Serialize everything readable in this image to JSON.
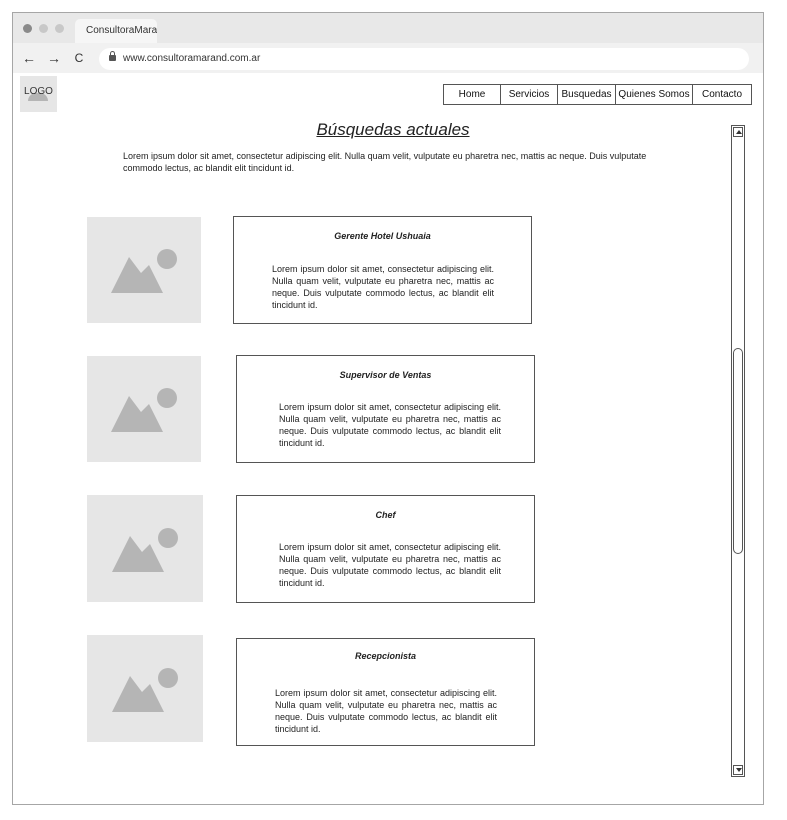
{
  "browser": {
    "tab_title": "ConsultoraMarand",
    "url": "www.consultoramarand.com.ar",
    "back_icon": "←",
    "forward_icon": "→",
    "reload_icon": "C"
  },
  "logo": {
    "text": "LOGO"
  },
  "nav": {
    "items": [
      "Home",
      "Servicios",
      "Busquedas",
      "Quienes Somos",
      "Contacto"
    ]
  },
  "page": {
    "title": "Búsquedas actuales",
    "intro": "Lorem ipsum dolor sit amet, consectetur adipiscing elit. Nulla quam velit, vulputate eu pharetra nec, mattis ac neque. Duis vulputate commodo lectus, ac blandit elit tincidunt id."
  },
  "jobs": [
    {
      "title": "Gerente Hotel Ushuaia",
      "body": "Lorem ipsum dolor sit amet, consectetur adipiscing elit. Nulla quam velit, vulputate eu pharetra nec, mattis ac neque. Duis vulputate commodo lectus, ac blandit elit tincidunt id."
    },
    {
      "title": "Supervisor de Ventas",
      "body": "Lorem ipsum dolor sit amet, consectetur adipiscing elit. Nulla quam velit, vulputate eu pharetra nec, mattis ac neque. Duis vulputate commodo lectus, ac blandit elit tincidunt id."
    },
    {
      "title": "Chef",
      "body": "Lorem ipsum dolor sit amet, consectetur adipiscing elit. Nulla quam velit, vulputate eu pharetra nec, mattis ac neque. Duis vulputate commodo lectus, ac blandit elit tincidunt id."
    },
    {
      "title": "Recepcionista",
      "body": "Lorem ipsum dolor sit amet, consectetur adipiscing elit. Nulla quam velit, vulputate eu pharetra nec, mattis ac neque. Duis vulputate commodo lectus, ac blandit elit tincidunt id."
    }
  ],
  "icons": {
    "image_placeholder": "image-placeholder-icon",
    "lock": "lock-icon"
  },
  "colors": {
    "border": "#555555",
    "placeholder_bg": "#e6e6e6",
    "placeholder_shape": "#b5b5b5",
    "chrome": "#e8e8e8"
  }
}
